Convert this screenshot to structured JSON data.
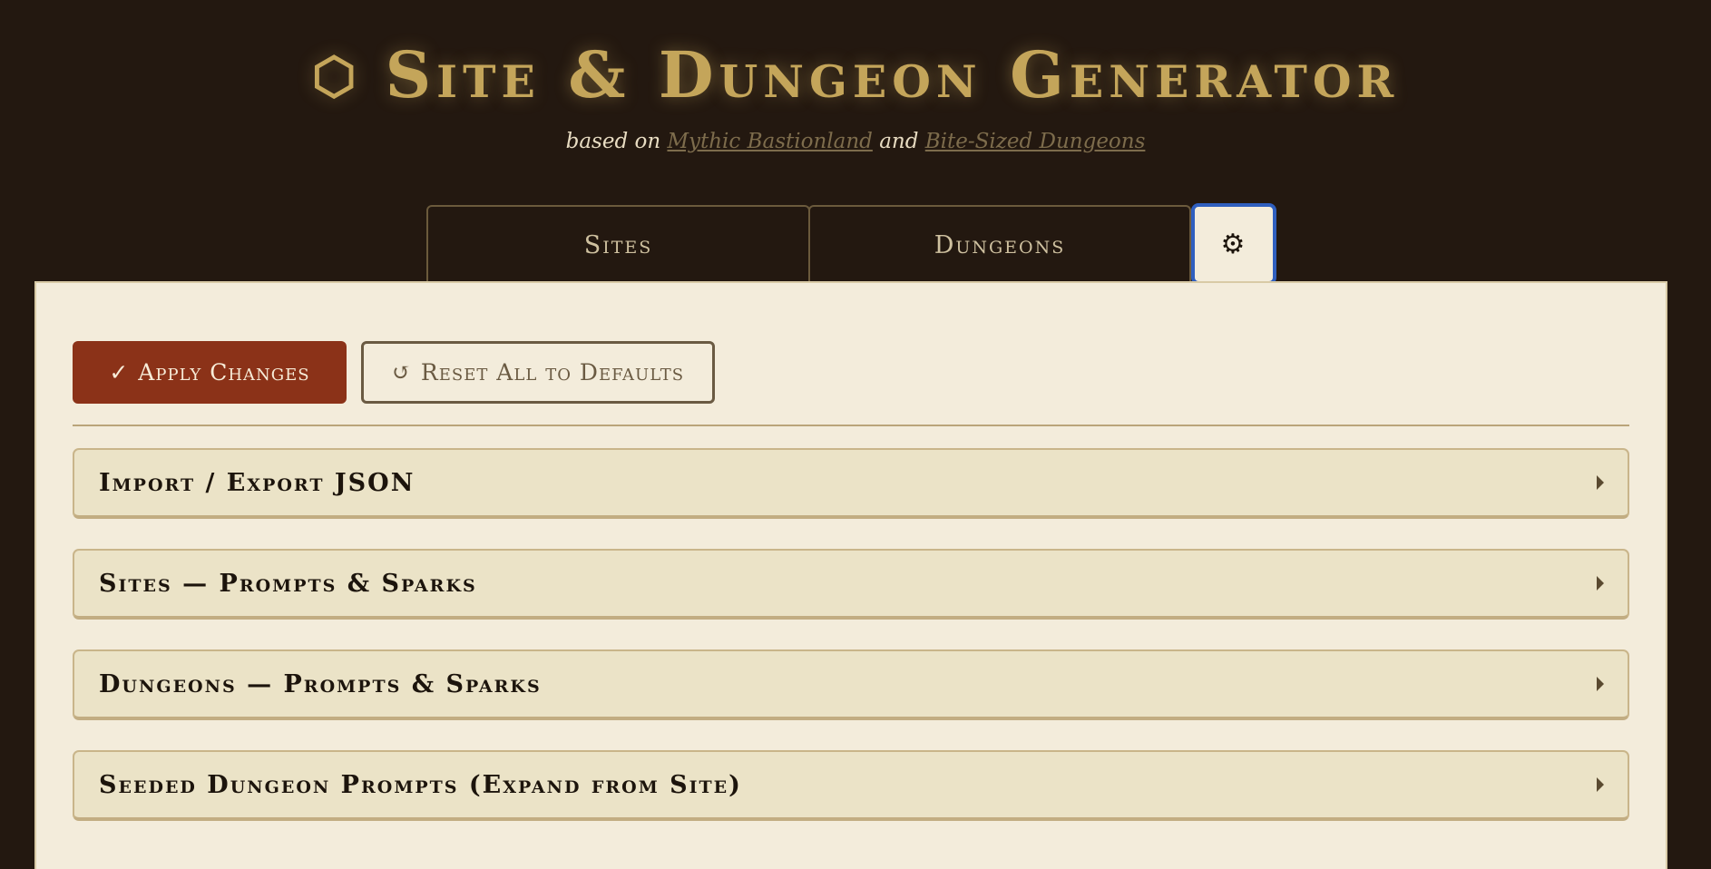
{
  "header": {
    "logo_icon": "hexagon-icon",
    "logo_glyph": "⬡",
    "title": "Site & Dungeon Generator",
    "subtitle_prefix": "based on",
    "subtitle_link_1": "Mythic Bastionland",
    "subtitle_and": "and",
    "subtitle_link_2": "Bite-Sized Dungeons"
  },
  "tabs": [
    {
      "label": "Sites",
      "active": false
    },
    {
      "label": "Dungeons",
      "active": false
    },
    {
      "label": "",
      "icon": "gear-icon",
      "glyph": "⚙",
      "active": true
    }
  ],
  "toolbar": {
    "apply_icon": "✓",
    "apply_label": "Apply Changes",
    "reset_icon": "↺",
    "reset_label": "Reset All to Defaults"
  },
  "sections": [
    {
      "title": "Import / Export JSON"
    },
    {
      "title": "Sites — Prompts & Sparks"
    },
    {
      "title": "Dungeons — Prompts & Sparks"
    },
    {
      "title": "Seeded Dungeon Prompts (Expand from Site)"
    }
  ],
  "colors": {
    "background": "#231810",
    "accent_gold": "#c4a55a",
    "panel": "#f3ecdb",
    "apply_button": "#8b3218",
    "focus_ring": "#2f5fbf"
  }
}
